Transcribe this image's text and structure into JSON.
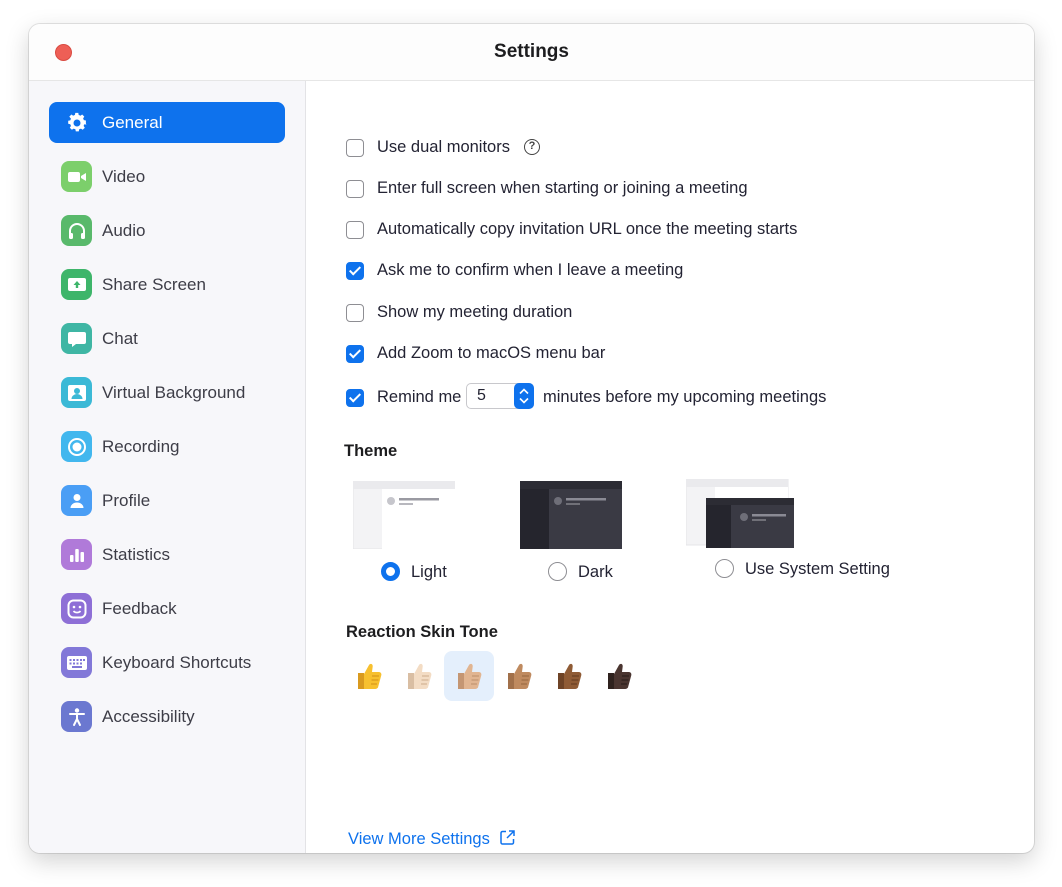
{
  "window": {
    "title": "Settings"
  },
  "sidebar": {
    "items": [
      {
        "label": "General",
        "icon": "gear-icon",
        "color": "#0e72ed",
        "active": true
      },
      {
        "label": "Video",
        "icon": "video-camera-icon",
        "color": "#7ccf6b"
      },
      {
        "label": "Audio",
        "icon": "headphones-icon",
        "color": "#59b96b"
      },
      {
        "label": "Share Screen",
        "icon": "share-screen-icon",
        "color": "#3eb56a"
      },
      {
        "label": "Chat",
        "icon": "chat-bubble-icon",
        "color": "#3fb6a4"
      },
      {
        "label": "Virtual Background",
        "icon": "virtual-background-icon",
        "color": "#3bb9d6"
      },
      {
        "label": "Recording",
        "icon": "record-icon",
        "color": "#42b7ee"
      },
      {
        "label": "Profile",
        "icon": "person-icon",
        "color": "#4a9ef5"
      },
      {
        "label": "Statistics",
        "icon": "bar-chart-icon",
        "color": "#b07ad9"
      },
      {
        "label": "Feedback",
        "icon": "smiley-icon",
        "color": "#8e6fd6"
      },
      {
        "label": "Keyboard Shortcuts",
        "icon": "keyboard-icon",
        "color": "#8278d8"
      },
      {
        "label": "Accessibility",
        "icon": "accessibility-icon",
        "color": "#6b78d0"
      }
    ]
  },
  "general": {
    "options": [
      {
        "label": "Use dual monitors",
        "checked": false,
        "help": "?"
      },
      {
        "label": "Enter full screen when starting or joining a meeting",
        "checked": false
      },
      {
        "label": "Automatically copy invitation URL once the meeting starts",
        "checked": false
      },
      {
        "label": "Ask me to confirm when I leave a meeting",
        "checked": true
      },
      {
        "label": "Show my meeting duration",
        "checked": false
      },
      {
        "label": "Add Zoom to macOS menu bar",
        "checked": true
      }
    ],
    "remind": {
      "checked": true,
      "prefix": "Remind me",
      "value": "5",
      "suffix": "minutes before my upcoming meetings"
    },
    "theme": {
      "title": "Theme",
      "options": [
        {
          "label": "Light",
          "selected": true
        },
        {
          "label": "Dark",
          "selected": false
        },
        {
          "label": "Use System Setting",
          "selected": false
        }
      ]
    },
    "skin_tone": {
      "title": "Reaction Skin Tone",
      "tones": [
        "#f7c02f",
        "#f3dcc4",
        "#e1b591",
        "#bf8a5f",
        "#8f5b35",
        "#4a3530"
      ],
      "selected_index": 2
    },
    "view_more": {
      "label": "View More Settings",
      "icon": "external-link-icon"
    }
  },
  "colors": {
    "accent": "#0e72ed"
  }
}
